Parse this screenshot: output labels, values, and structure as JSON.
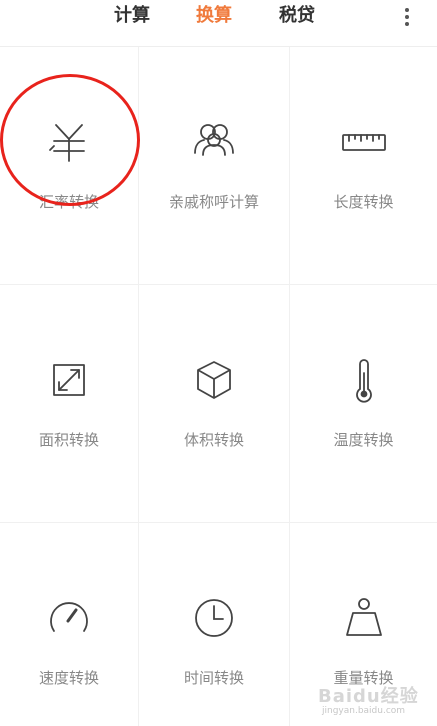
{
  "tabs": [
    {
      "label": "计算",
      "active": false
    },
    {
      "label": "换算",
      "active": true
    },
    {
      "label": "税贷",
      "active": false
    }
  ],
  "accent_color": "#f07a3c",
  "menu_icon": "more-vertical-icon",
  "items": [
    {
      "label": "汇率转换",
      "icon": "yen-currency-icon"
    },
    {
      "label": "亲戚称呼计算",
      "icon": "people-icon"
    },
    {
      "label": "长度转换",
      "icon": "ruler-icon"
    },
    {
      "label": "面积转换",
      "icon": "expand-arrows-icon"
    },
    {
      "label": "体积转换",
      "icon": "cube-icon"
    },
    {
      "label": "温度转换",
      "icon": "thermometer-icon"
    },
    {
      "label": "速度转换",
      "icon": "speedometer-icon"
    },
    {
      "label": "时间转换",
      "icon": "clock-icon"
    },
    {
      "label": "重量转换",
      "icon": "weight-icon"
    }
  ],
  "annotation_color": "#e8231c",
  "watermark": {
    "text": "Baidu经验",
    "url": "jingyan.baidu.com"
  }
}
